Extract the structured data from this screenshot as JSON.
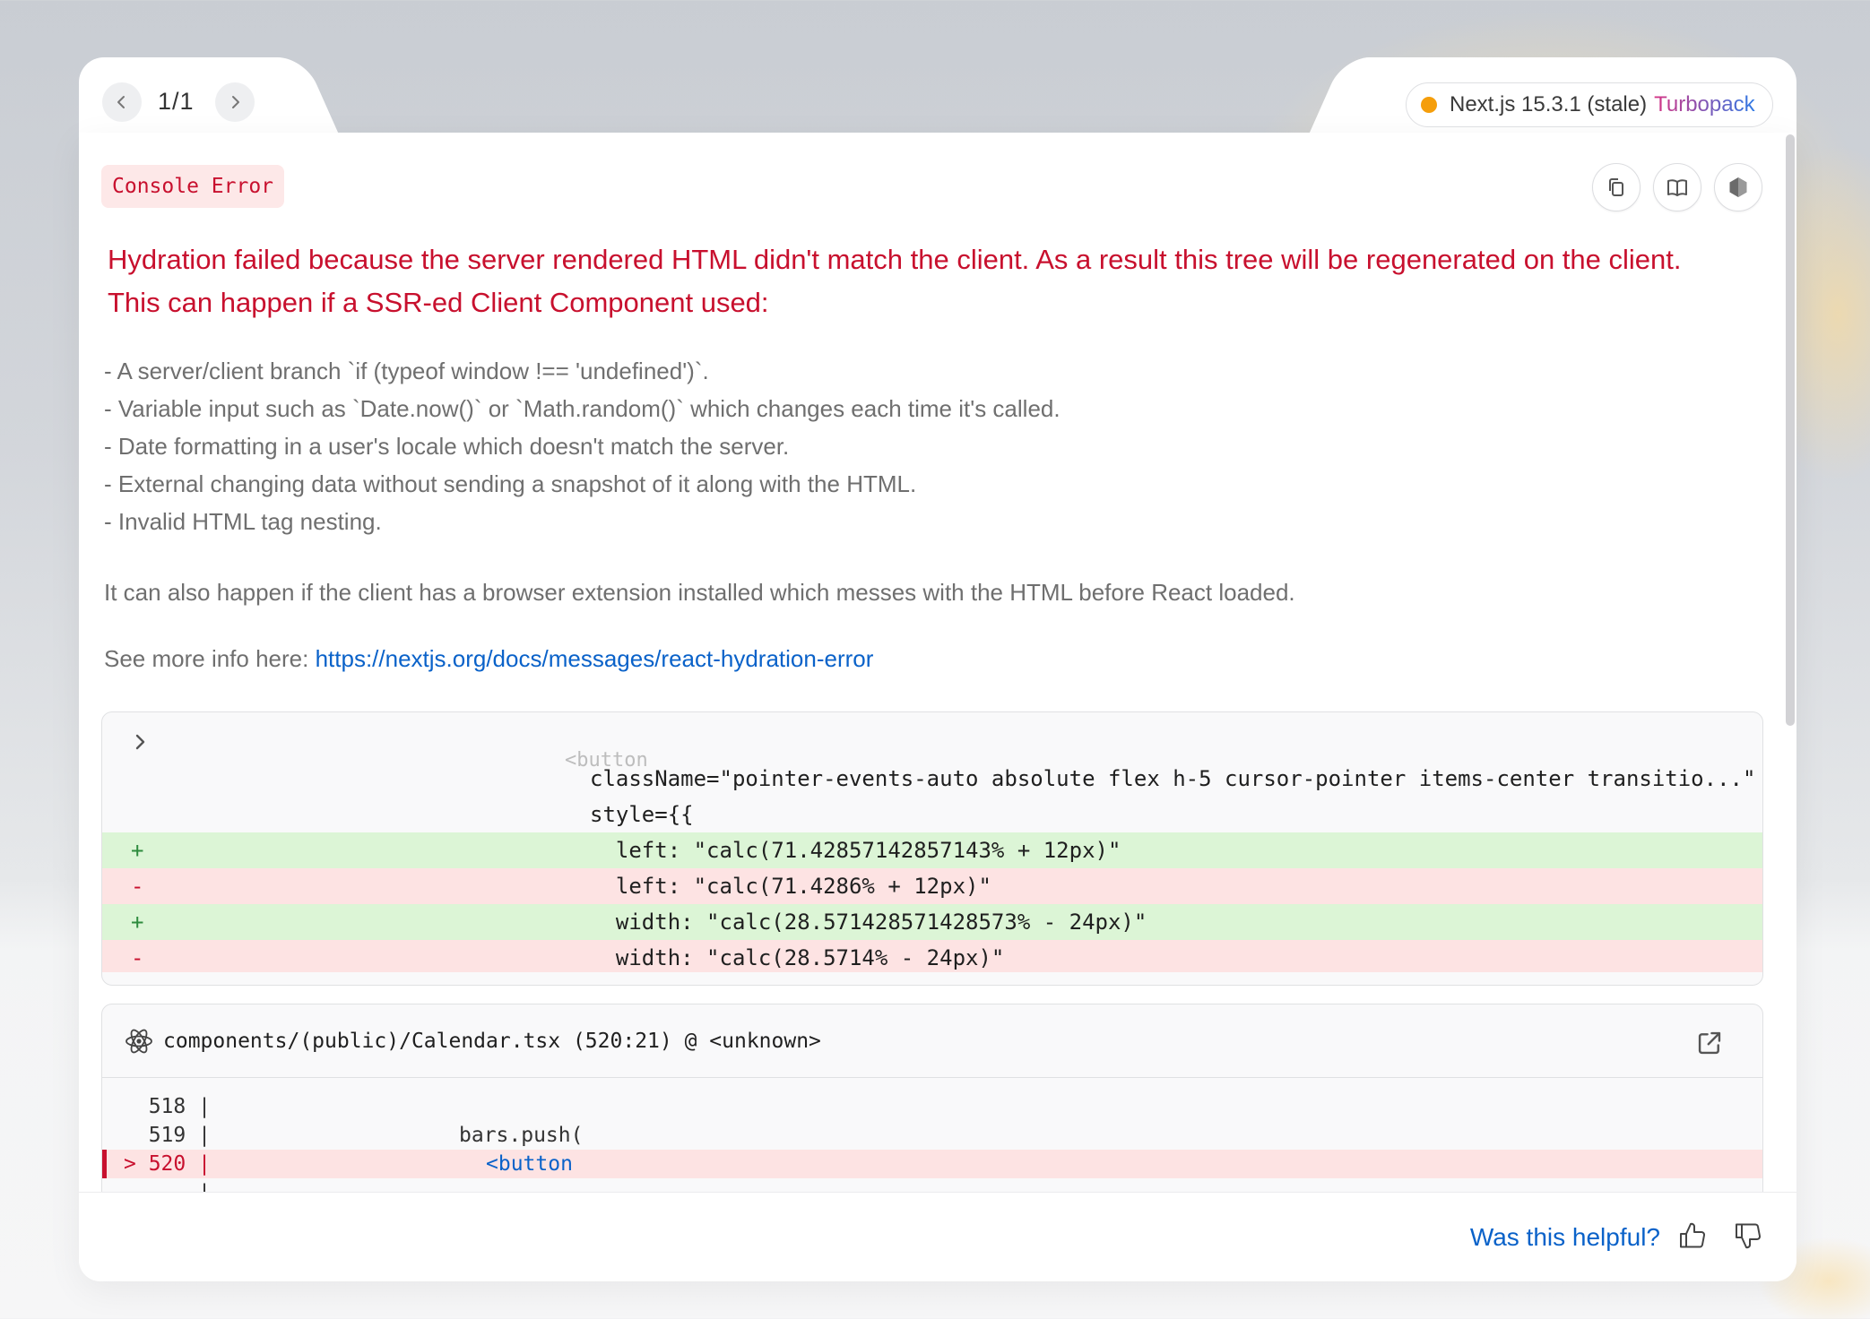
{
  "nav": {
    "counter": "1/1"
  },
  "version": {
    "label": "Next.js 15.3.1 (stale)",
    "bundler": "Turbopack",
    "status_color": "#f59e0b"
  },
  "error": {
    "badge": "Console Error",
    "headline_1": "Hydration failed because the server rendered HTML didn't match the client. As a result this tree will be regenerated on the client.",
    "headline_2": "This can happen if a SSR-ed Client Component used:",
    "bullets": [
      "- A server/client branch `if (typeof window !== 'undefined')`.",
      "- Variable input such as `Date.now()` or `Math.random()` which changes each time it's called.",
      "- Date formatting in a user's locale which doesn't match the server.",
      "- External changing data without sending a snapshot of it along with the HTML.",
      "- Invalid HTML tag nesting."
    ],
    "extra": "It can also happen if the client has a browser extension installed which messes with the HTML before React loaded.",
    "see_more_prefix": "See more info here: ",
    "see_more_link": "https://nextjs.org/docs/messages/react-hydration-error"
  },
  "toolbar": {
    "copy_icon": "copy-icon",
    "docs_icon": "book-icon",
    "node_icon": "nodejs-icon"
  },
  "diff": {
    "lines": [
      {
        "sign": "",
        "text": "<button",
        "type": "faded"
      },
      {
        "sign": "",
        "text": "className=\"pointer-events-auto absolute flex h-5 cursor-pointer items-center transitio...\"",
        "type": "ctx"
      },
      {
        "sign": "",
        "text": "style={{",
        "type": "ctx"
      },
      {
        "sign": "+",
        "text": "  left: \"calc(71.42857142857143% + 12px)\"",
        "type": "add"
      },
      {
        "sign": "-",
        "text": "  left: \"calc(71.4286% + 12px)\"",
        "type": "rem"
      },
      {
        "sign": "+",
        "text": "  width: \"calc(28.571428571428573% - 24px)\"",
        "type": "add"
      },
      {
        "sign": "-",
        "text": "  width: \"calc(28.5714% - 24px)\"",
        "type": "rem"
      }
    ]
  },
  "source": {
    "path": "components/(public)/Calendar.tsx (520:21) @ <unknown>",
    "lines": [
      {
        "num": "  518 |",
        "text": ""
      },
      {
        "num": "  519 |",
        "text": "bars.push("
      },
      {
        "num": "> 520 |",
        "text": "<button"
      },
      {
        "num": "      |",
        "text": ""
      }
    ]
  },
  "feedback": {
    "question": "Was this helpful?"
  }
}
